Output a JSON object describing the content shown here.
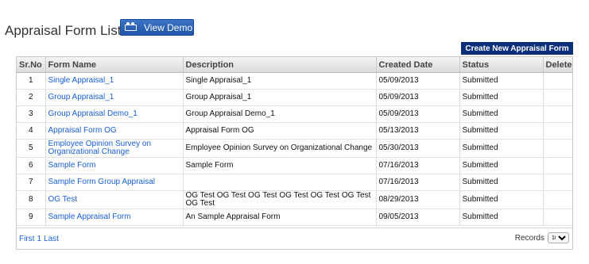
{
  "header": {
    "title": "Appraisal Form List",
    "demo_button": "View Demo",
    "create_button": "Create New Appraisal Form"
  },
  "table": {
    "columns": [
      "Sr.No",
      "Form Name",
      "Description",
      "Created Date",
      "Status",
      "Delete"
    ],
    "rows": [
      {
        "sr": "1",
        "name": "Single Appraisal_1",
        "description": "Single Appraisal_1",
        "created": "05/09/2013",
        "status": "Submitted",
        "delete": ""
      },
      {
        "sr": "2",
        "name": "Group Appraisal_1",
        "description": "Group Appraisal_1",
        "created": "05/09/2013",
        "status": "Submitted",
        "delete": ""
      },
      {
        "sr": "3",
        "name": "Group Appraisal Demo_1",
        "description": "Group Appraisal Demo_1",
        "created": "05/09/2013",
        "status": "Submitted",
        "delete": ""
      },
      {
        "sr": "4",
        "name": "Appraisal Form OG",
        "description": "Appraisal Form OG",
        "created": "05/13/2013",
        "status": "Submitted",
        "delete": ""
      },
      {
        "sr": "5",
        "name": "Employee Opinion Survey on Organizational Change",
        "description": "Employee Opinion Survey on Organizational Change",
        "created": "05/30/2013",
        "status": "Submitted",
        "delete": ""
      },
      {
        "sr": "6",
        "name": "Sample Form",
        "description": "Sample Form",
        "created": "07/16/2013",
        "status": "Submitted",
        "delete": ""
      },
      {
        "sr": "7",
        "name": "Sample Form Group Appraisal",
        "description": "",
        "created": "07/16/2013",
        "status": "Submitted",
        "delete": ""
      },
      {
        "sr": "8",
        "name": "OG Test",
        "description": "OG Test OG Test OG Test OG Test OG Test OG Test OG Test",
        "created": "08/29/2013",
        "status": "Submitted",
        "delete": ""
      },
      {
        "sr": "9",
        "name": "Sample Appraisal Form",
        "description": "An Sample Appraisal Form",
        "created": "09/05/2013",
        "status": "Submitted",
        "delete": ""
      }
    ]
  },
  "pager": {
    "first": "First",
    "page": "1",
    "last": "Last",
    "records_label": "Records",
    "records_value": "10"
  },
  "colors": {
    "link": "#1a5fd0",
    "create_button_bg": "#0d2f7a",
    "demo_button_bg": "#2a62b8"
  }
}
